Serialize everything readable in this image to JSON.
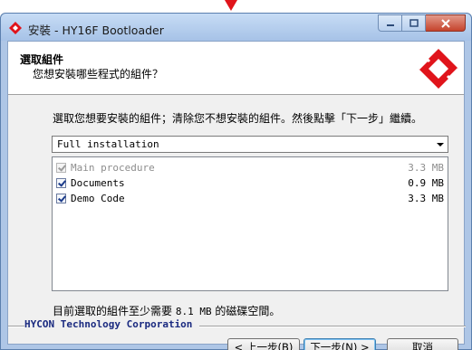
{
  "window": {
    "title": "安裝 - HY16F Bootloader",
    "caption_buttons": [
      "minimize-icon",
      "maximize-icon",
      "close-icon"
    ]
  },
  "header": {
    "title": "選取組件",
    "subtitle": "您想安裝哪些程式的組件？"
  },
  "body": {
    "instruction": "選取您想要安裝的組件；清除您不想安裝的組件。然後點擊「下一步」繼續。",
    "install_type": "Full installation",
    "components": [
      {
        "label": "Main procedure",
        "size": "3.3 MB",
        "checked": true,
        "enabled": false
      },
      {
        "label": "Documents",
        "size": "0.9 MB",
        "checked": true,
        "enabled": true
      },
      {
        "label": "Demo Code",
        "size": "3.3 MB",
        "checked": true,
        "enabled": true
      }
    ],
    "space_required_prefix": "目前選取的組件至少需要",
    "space_required_value": "8.1 MB",
    "space_required_suffix": "的磁碟空間。"
  },
  "footer": {
    "brand": "HYCON Technology Corporation",
    "back_label": "< 上一步(B)",
    "next_label": "下一步(N) >",
    "cancel_label": "取消"
  },
  "colors": {
    "logo_red": "#e0141b",
    "brand_blue": "#1a2a80",
    "close_button": "#c5432c"
  }
}
